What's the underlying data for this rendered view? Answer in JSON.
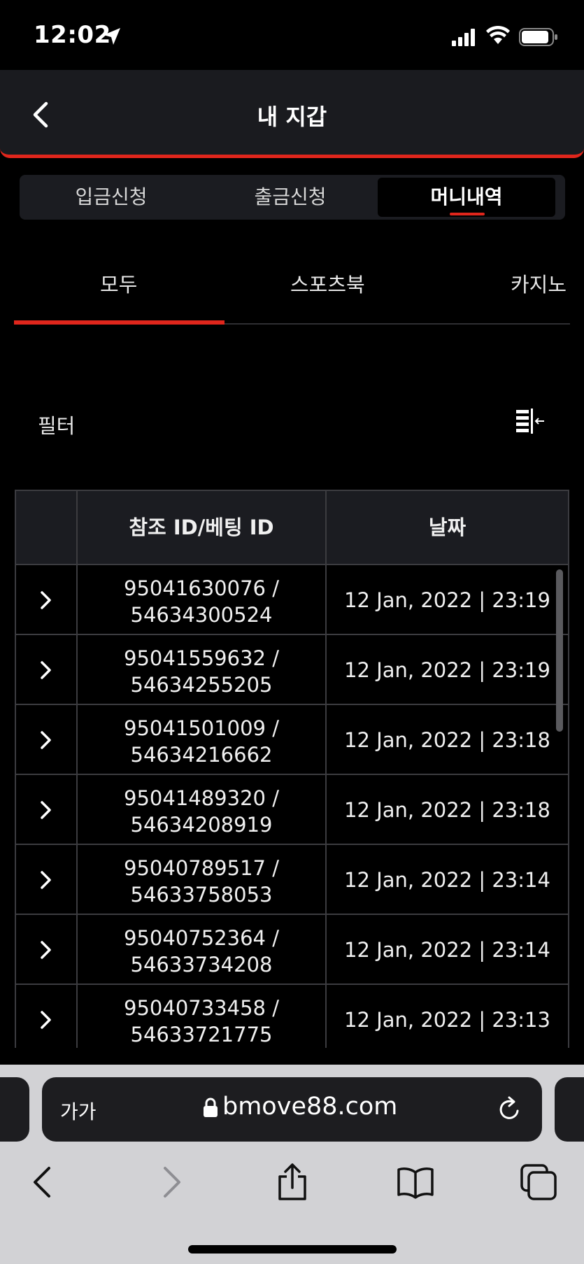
{
  "status_bar": {
    "time": "12:02"
  },
  "header": {
    "title": "내 지갑"
  },
  "segments": [
    {
      "label": "입금신청"
    },
    {
      "label": "출금신청"
    },
    {
      "label": "머니내역"
    }
  ],
  "categories": [
    {
      "label": "모두"
    },
    {
      "label": "스포츠북"
    },
    {
      "label": "카지노"
    }
  ],
  "filter": {
    "label": "필터"
  },
  "table": {
    "headers": [
      "",
      "참조 ID/베팅 ID",
      "날짜"
    ],
    "rows": [
      {
        "ref_line1": "95041630076 /",
        "ref_line2": "54634300524",
        "date": "12 Jan, 2022 | 23:19"
      },
      {
        "ref_line1": "95041559632 /",
        "ref_line2": "54634255205",
        "date": "12 Jan, 2022 | 23:19"
      },
      {
        "ref_line1": "95041501009 /",
        "ref_line2": "54634216662",
        "date": "12 Jan, 2022 | 23:18"
      },
      {
        "ref_line1": "95041489320 /",
        "ref_line2": "54634208919",
        "date": "12 Jan, 2022 | 23:18"
      },
      {
        "ref_line1": "95040789517 /",
        "ref_line2": "54633758053",
        "date": "12 Jan, 2022 | 23:14"
      },
      {
        "ref_line1": "95040752364 /",
        "ref_line2": "54633734208",
        "date": "12 Jan, 2022 | 23:14"
      },
      {
        "ref_line1": "95040733458 /",
        "ref_line2": "54633721775",
        "date": "12 Jan, 2022 | 23:13"
      }
    ]
  },
  "browser": {
    "text_size_label": "가가",
    "url": "bmove88.com"
  },
  "colors": {
    "accent": "#e0261c",
    "header_bg": "#1a1b1f",
    "page_bg": "#000000"
  }
}
